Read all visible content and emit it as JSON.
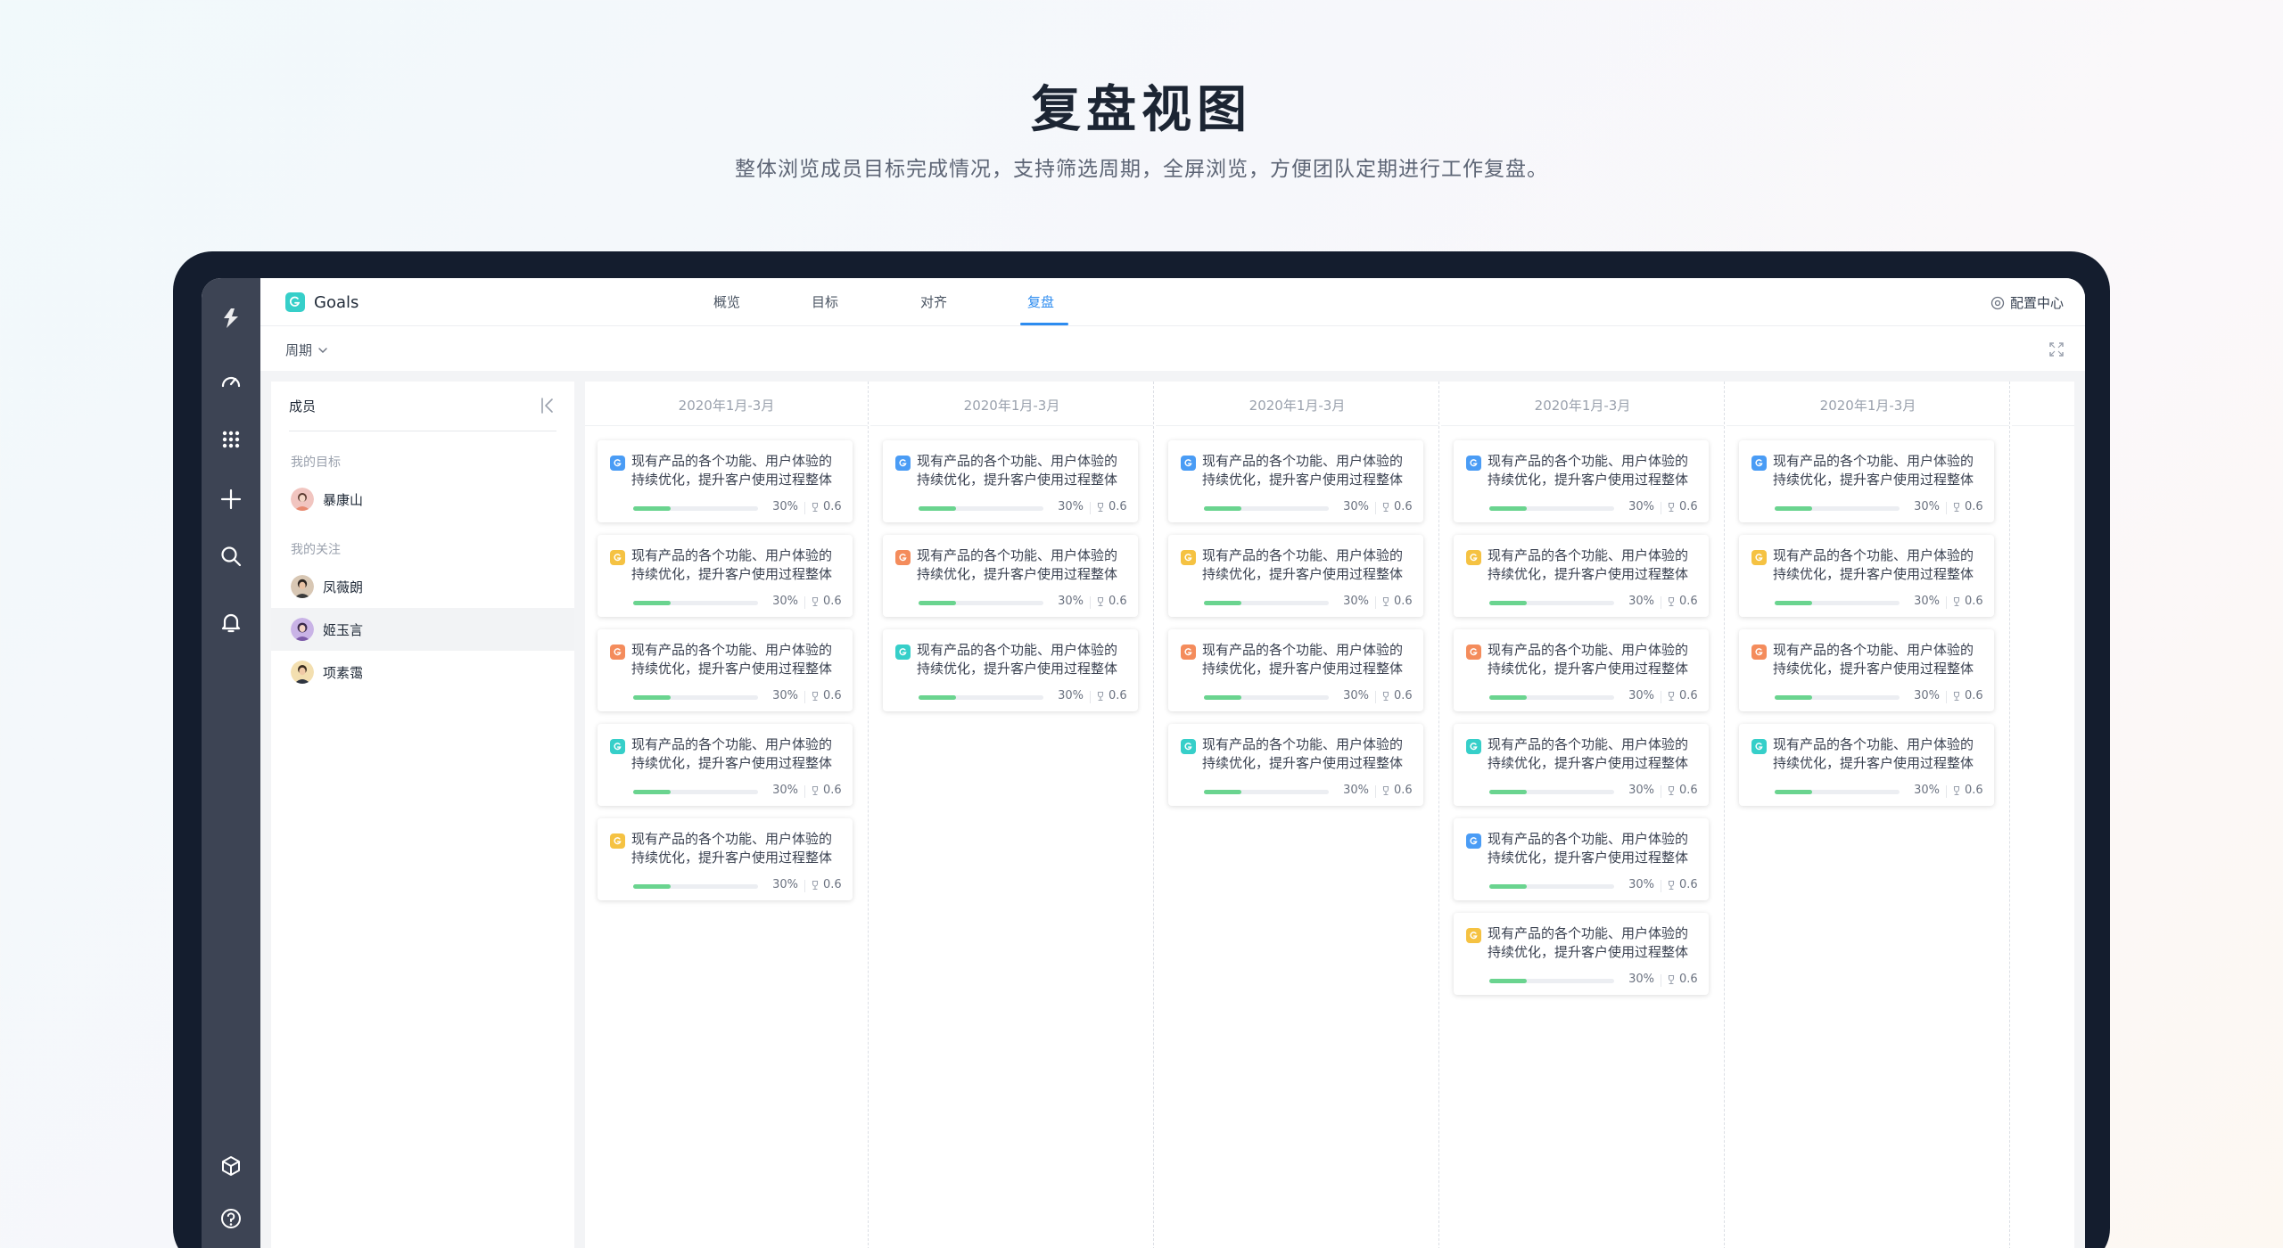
{
  "hero": {
    "title": "复盘视图",
    "subtitle": "整体浏览成员目标完成情况，支持筛选周期，全屏浏览，方便团队定期进行工作复盘。"
  },
  "rail": {
    "top_icons": [
      "logo-icon",
      "dashboard-icon",
      "apps-grid-icon",
      "plus-icon",
      "search-icon",
      "bell-icon"
    ],
    "bottom_icons": [
      "cube-icon",
      "help-icon"
    ]
  },
  "header": {
    "app_name": "Goals",
    "tabs": [
      {
        "label": "概览",
        "active": false
      },
      {
        "label": "目标",
        "active": false
      },
      {
        "label": "对齐",
        "active": false
      },
      {
        "label": "复盘",
        "active": true
      }
    ],
    "config_label": "配置中心"
  },
  "filter": {
    "period_label": "周期"
  },
  "members": {
    "title": "成员",
    "my_goals_label": "我的目标",
    "my_follow_label": "我的关注",
    "me": {
      "name": "暴康山"
    },
    "followed": [
      {
        "name": "凤薇朗",
        "selected": false
      },
      {
        "name": "姬玉言",
        "selected": true
      },
      {
        "name": "项素霭",
        "selected": false
      }
    ]
  },
  "colors": {
    "accent": "#2d8cf0",
    "progress": "#6ad48f",
    "icon_blue": "#4a9cf5",
    "icon_yellow": "#f5c242",
    "icon_orange": "#f48c5c",
    "icon_teal": "#36cfc9"
  },
  "board": {
    "columns": [
      {
        "period": "2020年1月-3月",
        "cards": [
          {
            "line1": "现有产品的各个功能、用户体验的",
            "line2": "持续优化，提升客户使用过程整体",
            "progress": 30,
            "progress_label": "30%",
            "score": "0.6",
            "icon_color": "blue"
          },
          {
            "line1": "现有产品的各个功能、用户体验的",
            "line2": "持续优化，提升客户使用过程整体",
            "progress": 30,
            "progress_label": "30%",
            "score": "0.6",
            "icon_color": "yellow"
          },
          {
            "line1": "现有产品的各个功能、用户体验的",
            "line2": "持续优化，提升客户使用过程整体",
            "progress": 30,
            "progress_label": "30%",
            "score": "0.6",
            "icon_color": "orange"
          },
          {
            "line1": "现有产品的各个功能、用户体验的",
            "line2": "持续优化，提升客户使用过程整体",
            "progress": 30,
            "progress_label": "30%",
            "score": "0.6",
            "icon_color": "teal"
          },
          {
            "line1": "现有产品的各个功能、用户体验的",
            "line2": "持续优化，提升客户使用过程整体",
            "progress": 30,
            "progress_label": "30%",
            "score": "0.6",
            "icon_color": "yellow"
          }
        ]
      },
      {
        "period": "2020年1月-3月",
        "cards": [
          {
            "line1": "现有产品的各个功能、用户体验的",
            "line2": "持续优化，提升客户使用过程整体",
            "progress": 30,
            "progress_label": "30%",
            "score": "0.6",
            "icon_color": "blue"
          },
          {
            "line1": "现有产品的各个功能、用户体验的",
            "line2": "持续优化，提升客户使用过程整体",
            "progress": 30,
            "progress_label": "30%",
            "score": "0.6",
            "icon_color": "orange"
          },
          {
            "line1": "现有产品的各个功能、用户体验的",
            "line2": "持续优化，提升客户使用过程整体",
            "progress": 30,
            "progress_label": "30%",
            "score": "0.6",
            "icon_color": "teal"
          }
        ]
      },
      {
        "period": "2020年1月-3月",
        "cards": [
          {
            "line1": "现有产品的各个功能、用户体验的",
            "line2": "持续优化，提升客户使用过程整体",
            "progress": 30,
            "progress_label": "30%",
            "score": "0.6",
            "icon_color": "blue"
          },
          {
            "line1": "现有产品的各个功能、用户体验的",
            "line2": "持续优化，提升客户使用过程整体",
            "progress": 30,
            "progress_label": "30%",
            "score": "0.6",
            "icon_color": "yellow"
          },
          {
            "line1": "现有产品的各个功能、用户体验的",
            "line2": "持续优化，提升客户使用过程整体",
            "progress": 30,
            "progress_label": "30%",
            "score": "0.6",
            "icon_color": "orange"
          },
          {
            "line1": "现有产品的各个功能、用户体验的",
            "line2": "持续优化，提升客户使用过程整体",
            "progress": 30,
            "progress_label": "30%",
            "score": "0.6",
            "icon_color": "teal"
          }
        ]
      },
      {
        "period": "2020年1月-3月",
        "cards": [
          {
            "line1": "现有产品的各个功能、用户体验的",
            "line2": "持续优化，提升客户使用过程整体",
            "progress": 30,
            "progress_label": "30%",
            "score": "0.6",
            "icon_color": "blue"
          },
          {
            "line1": "现有产品的各个功能、用户体验的",
            "line2": "持续优化，提升客户使用过程整体",
            "progress": 30,
            "progress_label": "30%",
            "score": "0.6",
            "icon_color": "yellow"
          },
          {
            "line1": "现有产品的各个功能、用户体验的",
            "line2": "持续优化，提升客户使用过程整体",
            "progress": 30,
            "progress_label": "30%",
            "score": "0.6",
            "icon_color": "orange"
          },
          {
            "line1": "现有产品的各个功能、用户体验的",
            "line2": "持续优化，提升客户使用过程整体",
            "progress": 30,
            "progress_label": "30%",
            "score": "0.6",
            "icon_color": "teal"
          },
          {
            "line1": "现有产品的各个功能、用户体验的",
            "line2": "持续优化，提升客户使用过程整体",
            "progress": 30,
            "progress_label": "30%",
            "score": "0.6",
            "icon_color": "blue"
          },
          {
            "line1": "现有产品的各个功能、用户体验的",
            "line2": "持续优化，提升客户使用过程整体",
            "progress": 30,
            "progress_label": "30%",
            "score": "0.6",
            "icon_color": "yellow"
          }
        ]
      },
      {
        "period": "2020年1月-3月",
        "cards": [
          {
            "line1": "现有产品的各个功能、用户体验的",
            "line2": "持续优化，提升客户使用过程整体",
            "progress": 30,
            "progress_label": "30%",
            "score": "0.6",
            "icon_color": "blue"
          },
          {
            "line1": "现有产品的各个功能、用户体验的",
            "line2": "持续优化，提升客户使用过程整体",
            "progress": 30,
            "progress_label": "30%",
            "score": "0.6",
            "icon_color": "yellow"
          },
          {
            "line1": "现有产品的各个功能、用户体验的",
            "line2": "持续优化，提升客户使用过程整体",
            "progress": 30,
            "progress_label": "30%",
            "score": "0.6",
            "icon_color": "orange"
          },
          {
            "line1": "现有产品的各个功能、用户体验的",
            "line2": "持续优化，提升客户使用过程整体",
            "progress": 30,
            "progress_label": "30%",
            "score": "0.6",
            "icon_color": "teal"
          }
        ]
      }
    ]
  }
}
